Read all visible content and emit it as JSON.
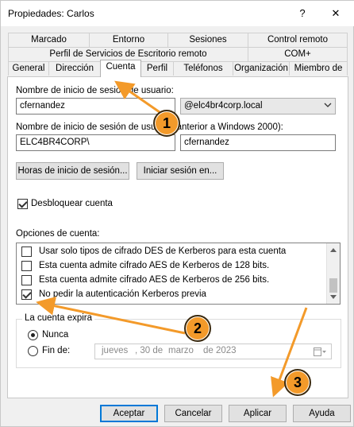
{
  "window": {
    "title": "Propiedades: Carlos",
    "help_glyph": "?",
    "close_glyph": "✕"
  },
  "tabs": {
    "row1": [
      "Marcado",
      "Entorno",
      "Sesiones",
      "Control remoto"
    ],
    "row2": [
      "Perfil de Servicios de Escritorio remoto",
      "COM+"
    ],
    "row3": [
      "General",
      "Dirección",
      "Cuenta",
      "Perfil",
      "Teléfonos",
      "Organización",
      "Miembro de"
    ],
    "active": "Cuenta"
  },
  "account": {
    "logon_name_label": "Nombre de inicio de sesión de usuario:",
    "logon_name_value": "cfernandez",
    "domain_value": "@elc4br4corp.local",
    "pre2000_label": "Nombre de inicio de sesión de usuario (anterior a Windows 2000):",
    "pre2000_domain": "ELC4BR4CORP\\",
    "pre2000_user": "cfernandez",
    "logon_hours_button": "Horas de inicio de sesión...",
    "logon_to_button": "Iniciar sesión en...",
    "unlock_label": "Desbloquear cuenta",
    "unlock_checked": true
  },
  "options": {
    "label": "Opciones de cuenta:",
    "items": [
      {
        "text": "Usar solo tipos de cifrado DES de Kerberos para esta cuenta",
        "checked": false
      },
      {
        "text": "Esta cuenta admite cifrado AES de Kerberos de 128 bits.",
        "checked": false
      },
      {
        "text": "Esta cuenta admite cifrado AES de Kerberos de 256 bits.",
        "checked": false
      },
      {
        "text": "No pedir la autenticación Kerberos previa",
        "checked": true
      }
    ]
  },
  "expiry": {
    "group_title": "La cuenta expira",
    "never_label": "Nunca",
    "never_selected": true,
    "end_label": "Fin de:",
    "date_weekday": "jueves",
    "date_day": ", 30 de",
    "date_month": "marzo",
    "date_year": "de 2023"
  },
  "footer": {
    "accept": "Aceptar",
    "cancel": "Cancelar",
    "apply": "Aplicar",
    "help": "Ayuda"
  },
  "annotations": [
    "1",
    "2",
    "3"
  ],
  "colors": {
    "badge": "#f39a2a",
    "arrow": "#f39a2a",
    "focus": "#0078d7"
  },
  "icons": {
    "dropdown": "chevron-down-icon",
    "calendar": "calendar-icon",
    "close": "close-icon",
    "help": "help-icon"
  }
}
